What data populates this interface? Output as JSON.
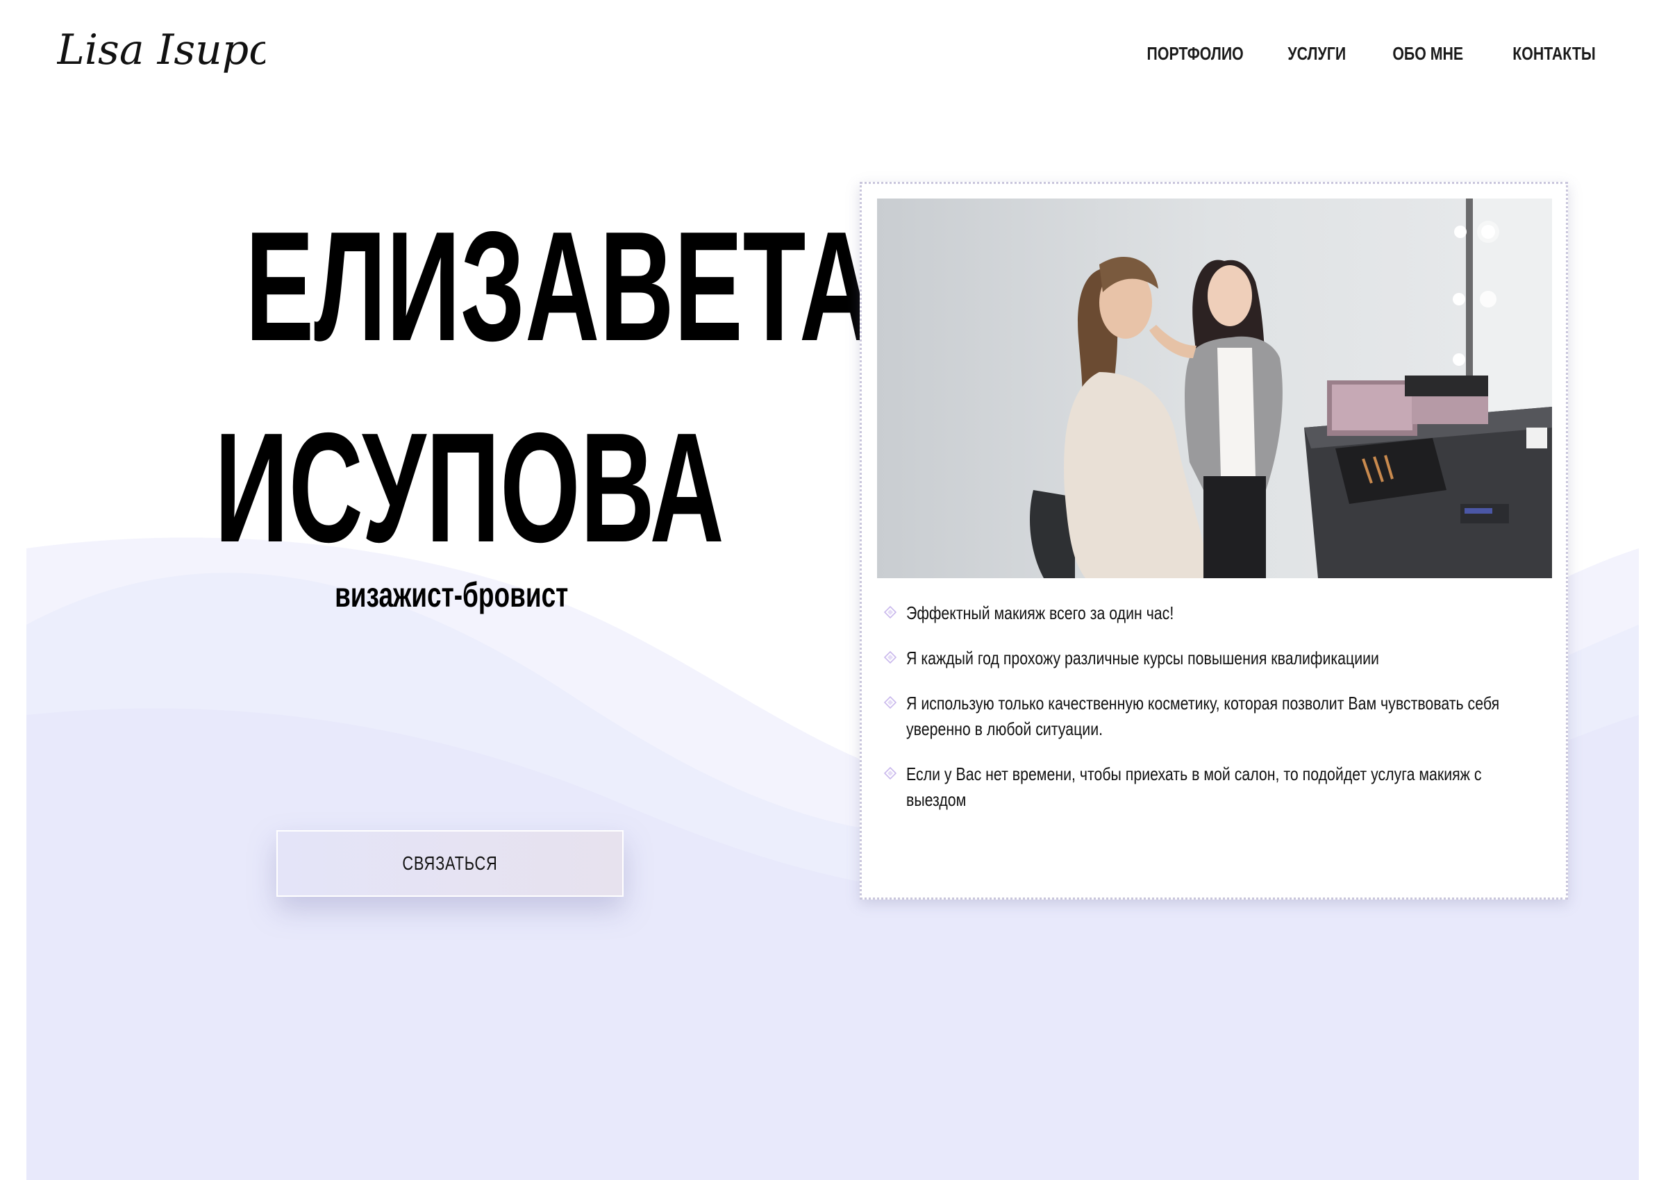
{
  "header": {
    "logo_text": "Lisa Isupova",
    "nav": [
      {
        "label": "ПОРТФОЛИО"
      },
      {
        "label": "УСЛУГИ"
      },
      {
        "label": "ОБО МНЕ"
      },
      {
        "label": "КОНТАКТЫ"
      }
    ]
  },
  "hero": {
    "first_name": "ЕЛИЗАВЕТА",
    "last_name": "ИСУПОВА",
    "subtitle": "визажист-бровист",
    "cta_label": "СВЯЗАТЬСЯ"
  },
  "card": {
    "photo_alt": "makeup-artist-at-work-photo",
    "benefits": [
      {
        "text": "Эффектный макияж всего за один час!"
      },
      {
        "text": "Я каждый год прохожу различные курсы повышения квалификациии"
      },
      {
        "text": "Я использую только качественную косметику, которая позволит Вам чувствовать себя уверенно в любой ситуации."
      },
      {
        "text": "Если у Вас нет времени, чтобы приехать в мой салон, то подойдет услуга макияж с выездом"
      }
    ]
  },
  "colors": {
    "background": "#ffffff",
    "wave_light": "#f3f3fd",
    "wave_main": "#e8e9fb",
    "accent_lilac": "#c9b8ec",
    "text": "#000000"
  },
  "icons": {
    "benefit_bullet": "diamond-icon"
  }
}
